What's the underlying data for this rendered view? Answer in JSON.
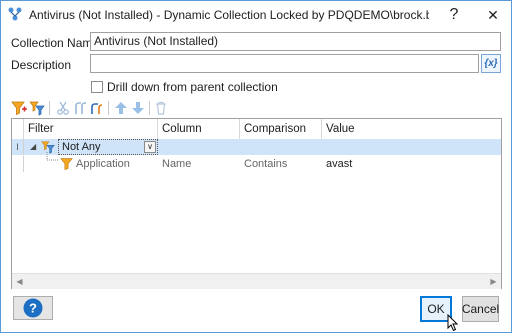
{
  "window": {
    "title": "Antivirus (Not Installed) - Dynamic Collection Locked by PDQDEMO\\brock.bingham on...",
    "icon": "collection-tree-icon",
    "help_glyph": "?",
    "close_glyph": "✕"
  },
  "form": {
    "collection_name_label": "Collection Name",
    "collection_name_value": "Antivirus (Not Installed)",
    "description_label": "Description",
    "description_value": "",
    "variable_button_label": "{x}",
    "drill_down_label": "Drill down from parent collection",
    "drill_down_checked": false
  },
  "toolbar": {
    "icons": [
      "add-filter-icon",
      "add-group-filter-icon",
      "cut-icon",
      "copy-icon",
      "paste-icon",
      "move-up-icon",
      "move-down-icon",
      "delete-icon"
    ]
  },
  "grid": {
    "columns": [
      "Filter",
      "Column",
      "Comparison",
      "Value"
    ],
    "rows": [
      {
        "indicator": "I",
        "expander": "◢",
        "filter": "Not Any",
        "column": "",
        "comparison": "",
        "value": "",
        "selected": true
      },
      {
        "indicator": "",
        "filter": "Application",
        "column": "Name",
        "comparison": "Contains",
        "value": "avast",
        "selected": false
      }
    ],
    "combo_glyph": "∨"
  },
  "buttons": {
    "help_glyph": "?",
    "ok": "OK",
    "cancel": "Cancel"
  },
  "colors": {
    "accent": "#0078d7",
    "selection": "#cfe4f8",
    "help_blue": "#1c6fc2",
    "filter_orange": "#f5a623"
  }
}
